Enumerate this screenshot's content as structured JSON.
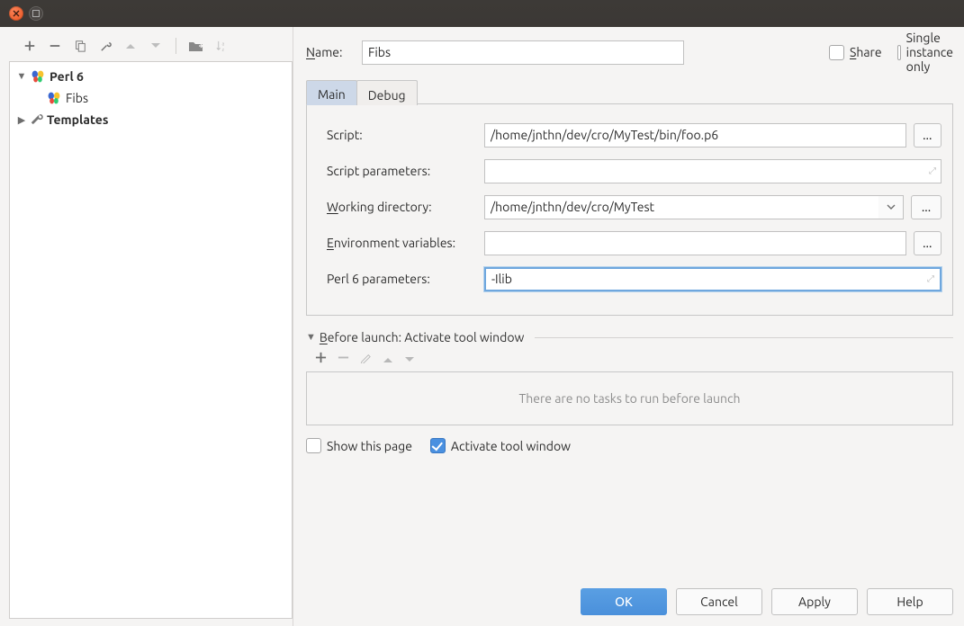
{
  "window": {
    "close_icon": "close",
    "min_icon": "minimize"
  },
  "toolbar_icons": {
    "add": "plus",
    "remove": "minus",
    "copy": "copy",
    "wrench": "wrench",
    "up": "up",
    "down": "down",
    "folder": "folder-arrow",
    "sort": "sort-az"
  },
  "tree": {
    "root": {
      "label": "Perl 6",
      "icon": "butterfly"
    },
    "child": {
      "label": "Fibs",
      "icon": "butterfly"
    },
    "templates": {
      "label": "Templates",
      "icon": "wrench"
    }
  },
  "name": {
    "label": "Name:",
    "label_u": "N",
    "value": "Fibs"
  },
  "share": {
    "label": "Share",
    "label_u": "S",
    "checked": false
  },
  "single_instance": {
    "label": "Single instance only",
    "checked": false
  },
  "tabs": {
    "main": "Main",
    "debug": "Debug"
  },
  "form": {
    "script": {
      "label": "Script:",
      "value": "/home/jnthn/dev/cro/MyTest/bin/foo.p6",
      "ellipsis": "..."
    },
    "script_params": {
      "label": "Script parameters:",
      "value": ""
    },
    "working_dir": {
      "label": "Working directory:",
      "label_u": "W",
      "value": "/home/jnthn/dev/cro/MyTest",
      "ellipsis": "..."
    },
    "env_vars": {
      "label": "Environment variables:",
      "label_u": "E",
      "value": "",
      "ellipsis": "..."
    },
    "perl6": {
      "label": "Perl 6 parameters:",
      "value": "-Ilib"
    }
  },
  "before_launch": {
    "title": "Before launch: Activate tool window",
    "title_u": "B",
    "empty": "There are no tasks to run before launch"
  },
  "show_this_page": {
    "label": "Show this page",
    "checked": false
  },
  "activate_tool": {
    "label": "Activate tool window",
    "checked": true
  },
  "buttons": {
    "ok": "OK",
    "cancel": "Cancel",
    "apply": "Apply",
    "help": "Help"
  }
}
